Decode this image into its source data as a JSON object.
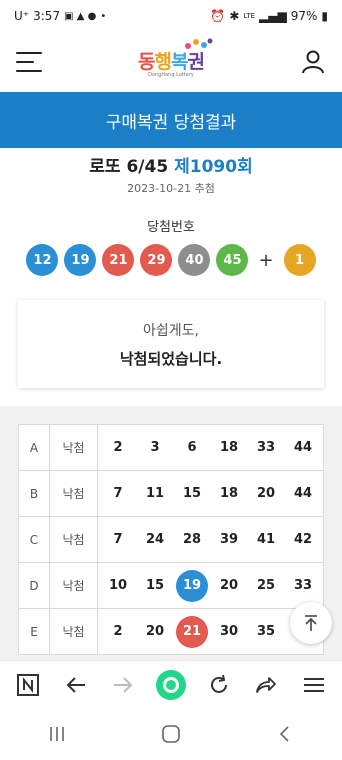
{
  "status_bar": {
    "carrier": "U⁺",
    "time": "3:57",
    "network": "LTE",
    "battery": "97%"
  },
  "header": {
    "logo_text_parts": [
      "동",
      "행",
      "복",
      "권"
    ],
    "logo_sub": "DongHang Lottery"
  },
  "title_bar": {
    "title": "구매복권 당첨결과"
  },
  "draw": {
    "game": "로또 6/45",
    "round": "제1090회",
    "date": "2023-10-21 추첨"
  },
  "winning": {
    "label": "당첨번호",
    "numbers": [
      {
        "value": "12",
        "color": "#2b8fd6"
      },
      {
        "value": "19",
        "color": "#2b8fd6"
      },
      {
        "value": "21",
        "color": "#e35a4e"
      },
      {
        "value": "29",
        "color": "#e35a4e"
      },
      {
        "value": "40",
        "color": "#8e8e8e"
      },
      {
        "value": "45",
        "color": "#5cb848"
      }
    ],
    "plus": "+",
    "bonus": {
      "value": "1",
      "color": "#e8a722"
    }
  },
  "result": {
    "sub": "아쉽게도,",
    "main": "낙첨되었습니다."
  },
  "ticket": {
    "rows": [
      {
        "slot": "A",
        "status": "낙첨",
        "numbers": [
          "2",
          "3",
          "6",
          "18",
          "33",
          "44"
        ],
        "hits": []
      },
      {
        "slot": "B",
        "status": "낙첨",
        "numbers": [
          "7",
          "11",
          "15",
          "18",
          "20",
          "44"
        ],
        "hits": []
      },
      {
        "slot": "C",
        "status": "낙첨",
        "numbers": [
          "7",
          "24",
          "28",
          "39",
          "41",
          "42"
        ],
        "hits": []
      },
      {
        "slot": "D",
        "status": "낙첨",
        "numbers": [
          "10",
          "15",
          "19",
          "20",
          "25",
          "33"
        ],
        "hits": [
          {
            "index": 2,
            "color": "#2b8fd6"
          }
        ]
      },
      {
        "slot": "E",
        "status": "낙첨",
        "numbers": [
          "2",
          "20",
          "21",
          "30",
          "35",
          ""
        ],
        "hits": [
          {
            "index": 2,
            "color": "#e35a4e"
          }
        ]
      }
    ]
  },
  "icons": {
    "menu": "hamburger-menu-icon",
    "user": "user-icon",
    "scroll_top": "arrow-up-icon",
    "browser": [
      "n-home-icon",
      "back-arrow-icon",
      "forward-arrow-icon",
      "circle-tab-icon",
      "refresh-icon",
      "share-icon",
      "browser-menu-icon"
    ],
    "nav": [
      "recent-apps-icon",
      "home-icon",
      "back-icon"
    ]
  },
  "colors": {
    "primary": "#1b7fc8",
    "accent_green": "#22d68a"
  }
}
